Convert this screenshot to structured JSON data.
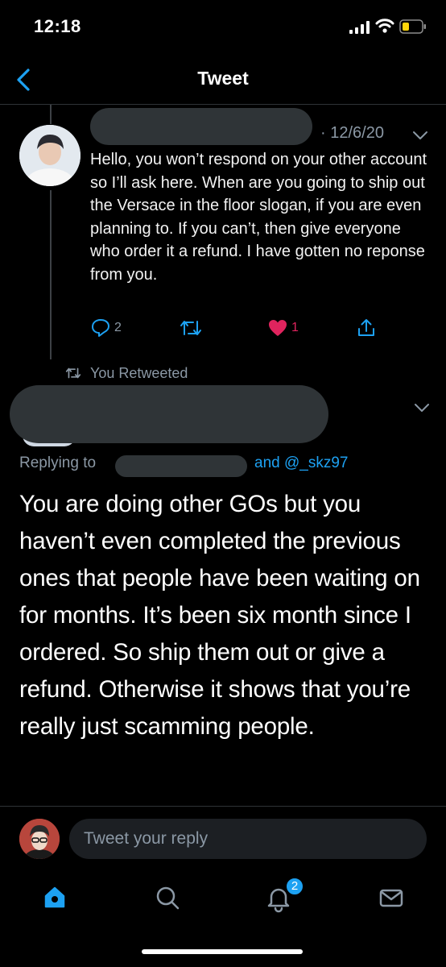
{
  "status_bar": {
    "time": "12:18"
  },
  "nav": {
    "title": "Tweet"
  },
  "first_tweet": {
    "date": "· 12/6/20",
    "text": "Hello, you won’t respond on your other account so I’ll ask here. When are you going to ship out the Versace in the floor slogan, if you are even planning to. If you can’t, then give everyone who order it a refund. I have gotten no reponse from you.",
    "reply_count": "2",
    "like_count": "1"
  },
  "retweet_context": {
    "label": "You Retweeted"
  },
  "main_tweet": {
    "replying_prefix": "Replying to",
    "replying_suffix": "and @_skz97",
    "text": "You are doing other GOs but you haven’t even completed the previous ones that people have been waiting on for months. It’s been six month since I ordered. So ship them out or give a refund. Otherwise it shows that you’re really just scamming people."
  },
  "reply_bar": {
    "placeholder": "Tweet your reply"
  },
  "tab_bar": {
    "notifications_badge": "2"
  },
  "colors": {
    "accent": "#1da1f2",
    "like": "#e0245e",
    "muted": "#8b98a5",
    "background": "#000000"
  }
}
